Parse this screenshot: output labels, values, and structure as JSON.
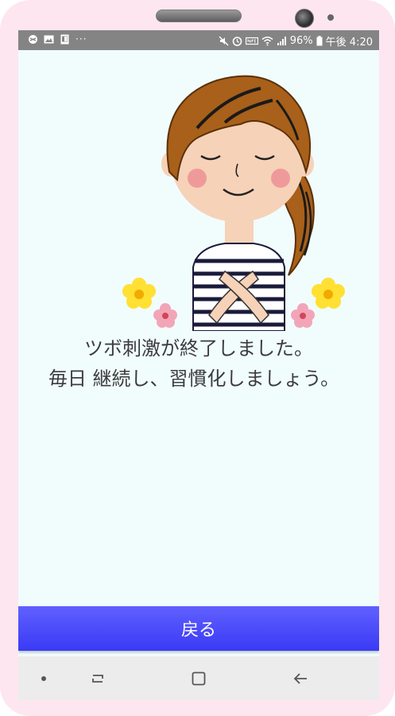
{
  "status_bar": {
    "battery_percent": "96%",
    "time": "午後 4:20",
    "more_indicator": "···"
  },
  "message": {
    "line1": "ツボ刺激が終了しました。",
    "line2": "毎日 継続し、習慣化しましょう。"
  },
  "back_button": {
    "label": "戻る"
  },
  "colors": {
    "screen_bg": "#f1fcfd",
    "button": "#4444f8",
    "phone_frame": "#fde6f0",
    "status_bar": "#848484"
  },
  "icons": [
    "sync-icon",
    "image-icon",
    "tablet-icon",
    "mute-icon",
    "alarm-icon",
    "nfc-icon",
    "wifi-icon",
    "signal-icon",
    "battery-icon",
    "recent-apps-icon",
    "home-icon",
    "back-arrow-icon",
    "nav-dot-icon"
  ]
}
